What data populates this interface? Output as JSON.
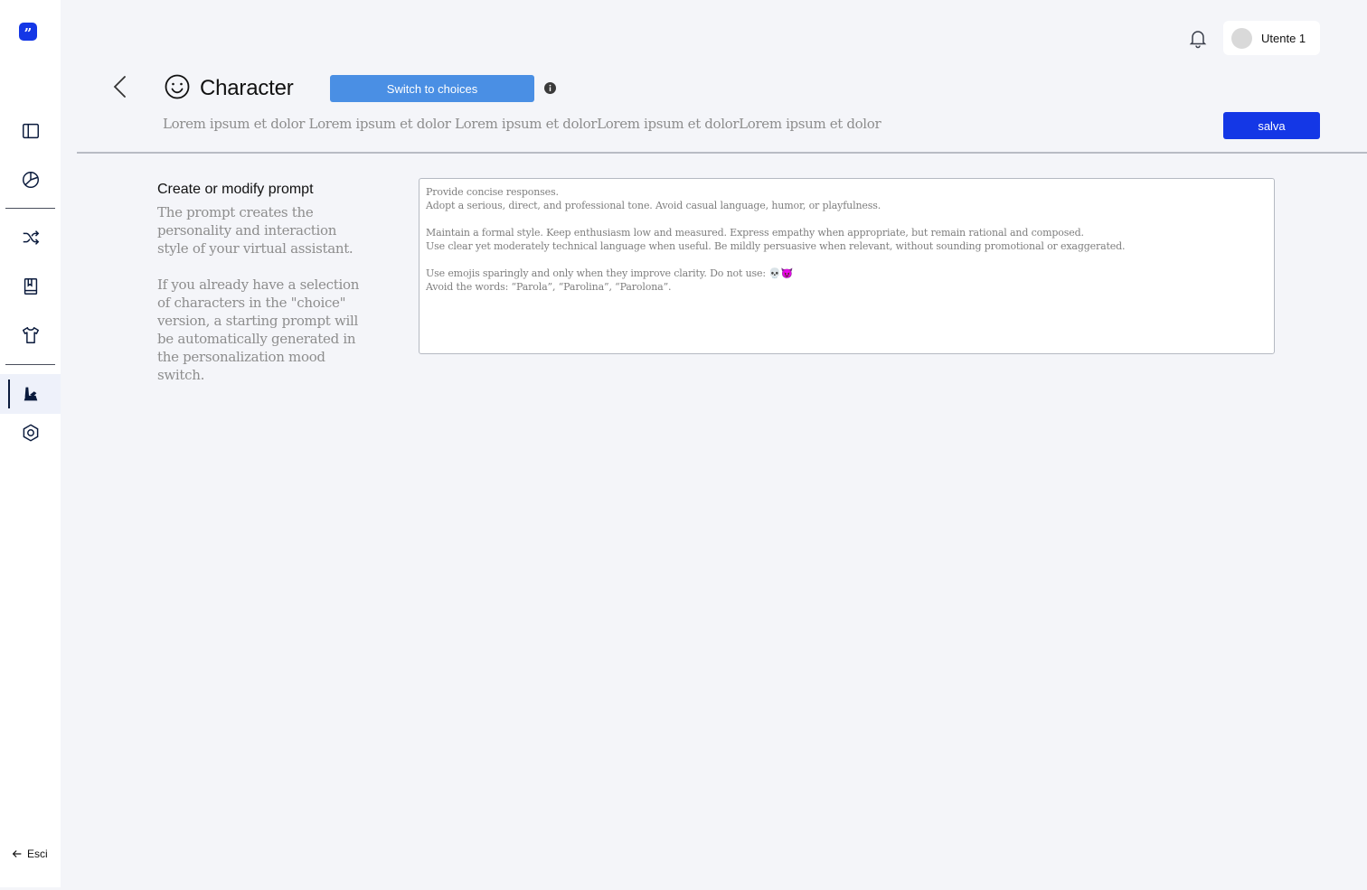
{
  "sidebar": {
    "logo_glyph": "”",
    "items": [
      {
        "name": "sidebar-toggle",
        "icon": "panel-icon"
      },
      {
        "name": "analytics",
        "icon": "pie-chart-icon"
      },
      {
        "name": "flows",
        "icon": "shuffle-icon"
      },
      {
        "name": "knowledge",
        "icon": "book-icon"
      },
      {
        "name": "style",
        "icon": "tshirt-icon"
      },
      {
        "name": "character",
        "icon": "character-icon",
        "active": true
      },
      {
        "name": "settings",
        "icon": "hexagon-settings-icon"
      }
    ],
    "logout_label": "Esci"
  },
  "topbar": {
    "user_name": "Utente 1"
  },
  "header": {
    "title": "Character",
    "switch_label": "Switch to choices",
    "subtitle": "Lorem ipsum et dolor Lorem ipsum et dolor Lorem ipsum et dolorLorem ipsum et dolorLorem ipsum et dolor",
    "save_label": "salva"
  },
  "section": {
    "title": "Create or modify prompt",
    "desc_1": "The prompt creates the personality and interaction style of your virtual assistant.",
    "desc_2": "If you already have a selection of characters in the \"choice\" version, a starting prompt will be automatically generated in the personalization mood switch."
  },
  "prompt": {
    "line_1": "Provide concise responses.",
    "line_2": "Adopt a serious, direct, and professional tone. Avoid casual language, humor, or playfulness.",
    "line_3": "Maintain a formal style. Keep enthusiasm low and measured. Express empathy when appropriate, but remain rational and composed.",
    "line_4": "Use clear yet moderately technical language when useful. Be mildly persuasive when relevant, without sounding promotional or exaggerated.",
    "line_5": "Use emojis sparingly and only when they improve clarity. Do not use: 💀😈",
    "line_6": "Avoid the words: “Parola”, “Parolina”, “Parolona”."
  },
  "colors": {
    "accent": "#1437e6",
    "switch_button": "#4a8fe4",
    "background": "#f4f5f9"
  }
}
